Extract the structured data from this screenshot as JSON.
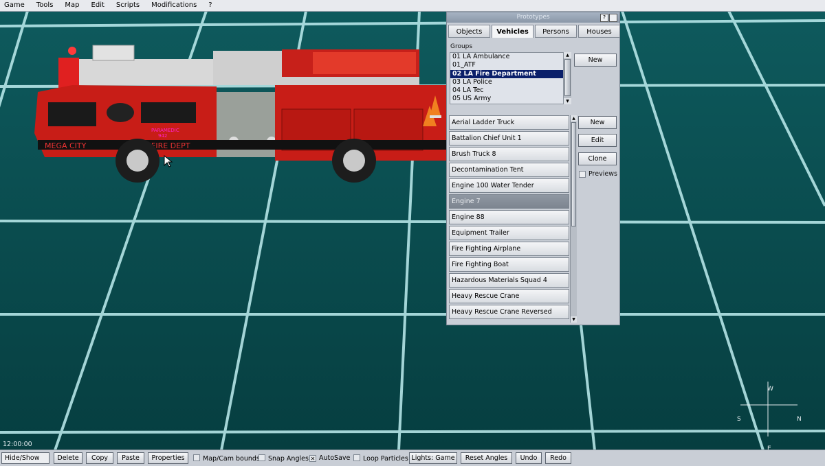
{
  "menubar": {
    "items": [
      "Game",
      "Tools",
      "Map",
      "Edit",
      "Scripts",
      "Modifications",
      "?"
    ]
  },
  "viewport": {
    "truck_text": {
      "city": "MEGA CITY",
      "dept": "FIRE DEPT",
      "unit": "PARAMEDIC",
      "unit_no": "942"
    },
    "clock": "12:00:00",
    "compass": {
      "north": "N",
      "south": "S",
      "east": "E",
      "west": "W"
    }
  },
  "prototypes": {
    "title": "Prototypes",
    "help_btn": "?",
    "tabs": [
      "Objects",
      "Vehicles",
      "Persons",
      "Houses"
    ],
    "active_tab": "Vehicles",
    "groups_label": "Groups",
    "groups": [
      "01 LA Ambulance",
      "01_ATF",
      "02 LA Fire Department",
      "03 LA Police",
      "04 LA Tec",
      "05 US Army"
    ],
    "selected_group": "02 LA Fire Department",
    "group_new": "New",
    "vehicles": [
      "Aerial Ladder Truck",
      "Battalion Chief Unit 1",
      "Brush Truck 8",
      "Decontamination Tent",
      "Engine 100 Water Tender",
      "Engine 7",
      "Engine 88",
      "Equipment Trailer",
      "Fire Fighting Airplane",
      "Fire Fighting Boat",
      "Hazardous Materials Squad 4",
      "Heavy Rescue Crane",
      "Heavy Rescue Crane Reversed"
    ],
    "selected_vehicle": "Engine 7",
    "actions": {
      "new": "New",
      "edit": "Edit",
      "clone": "Clone",
      "previews": "Previews"
    }
  },
  "toolbar": {
    "hide_show": "Hide/Show",
    "delete": "Delete",
    "copy": "Copy",
    "paste": "Paste",
    "properties": "Properties",
    "map_cam_bounds": "Map/Cam bounds",
    "snap_angles": "Snap Angles",
    "autosave": "AutoSave",
    "autosave_checked": true,
    "loop_particles": "Loop Particles",
    "lights": "Lights: Game",
    "reset_angles": "Reset Angles",
    "undo": "Undo",
    "redo": "Redo"
  }
}
